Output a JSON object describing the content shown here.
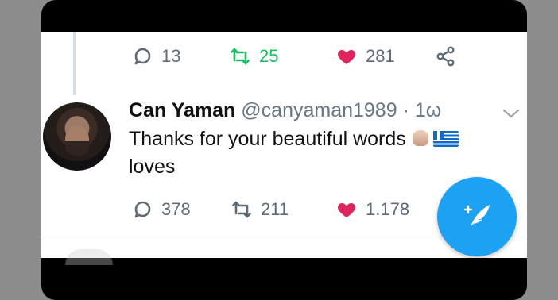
{
  "previous_tweet": {
    "actions": {
      "reply_count": "13",
      "retweet_count": "25",
      "like_count": "281"
    }
  },
  "tweet": {
    "display_name": "Can Yaman",
    "handle": "@canyaman1989",
    "separator": "·",
    "time": "1ω",
    "text_line1": "Thanks for your beautiful words",
    "text_line2": "loves",
    "actions": {
      "reply_count": "378",
      "retweet_count": "211",
      "like_count": "1.178"
    }
  },
  "colors": {
    "retweet_green": "#17bf63",
    "like_red": "#e0245e",
    "compose_blue": "#1da1f2"
  },
  "icons": {
    "reply": "speech-bubble-icon",
    "retweet": "retweet-arrows-icon",
    "like": "heart-icon",
    "share": "share-icon",
    "menu": "chevron-down-icon",
    "compose": "feather-plus-icon"
  }
}
